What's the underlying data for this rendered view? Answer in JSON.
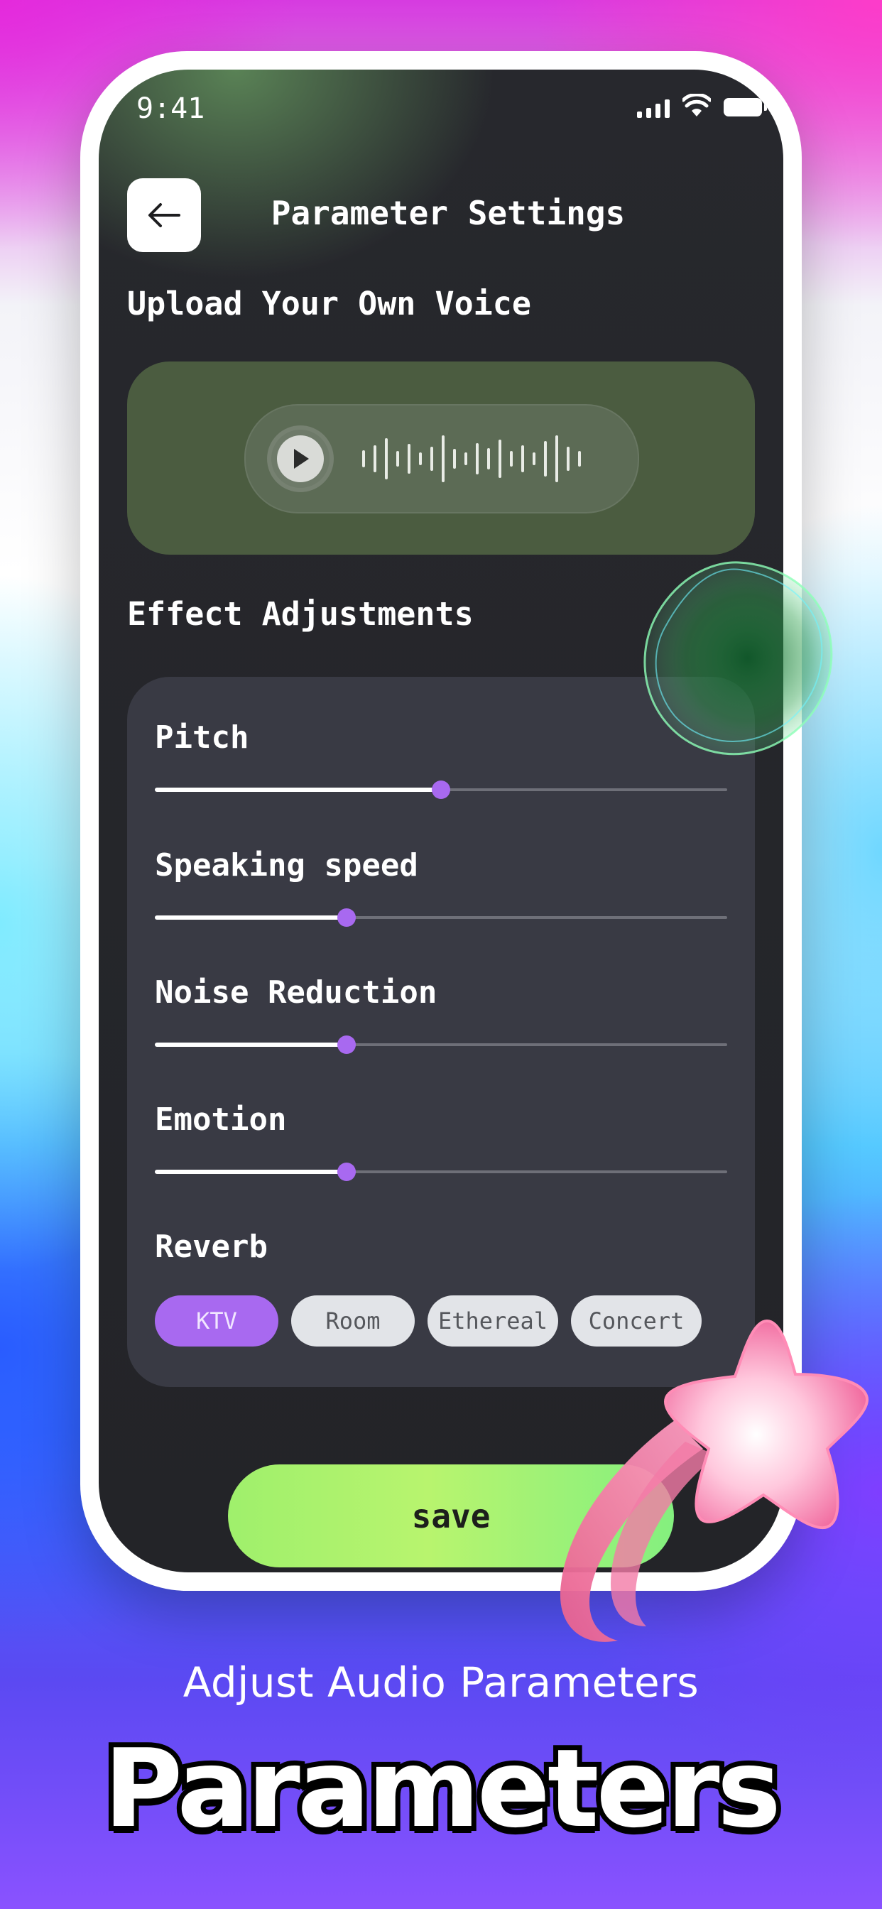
{
  "status_bar": {
    "time": "9:41"
  },
  "header": {
    "title": "Parameter Settings"
  },
  "upload_section": {
    "title": "Upload Your Own Voice"
  },
  "effects_section": {
    "title": "Effect Adjustments",
    "params": [
      {
        "label": "Pitch",
        "value": 0.5
      },
      {
        "label": "Speaking speed",
        "value": 0.335
      },
      {
        "label": "Noise Reduction",
        "value": 0.335
      },
      {
        "label": "Emotion",
        "value": 0.335
      }
    ],
    "reverb": {
      "label": "Reverb",
      "options": [
        "KTV",
        "Room",
        "Ethereal",
        "Concert"
      ],
      "selected": "KTV"
    }
  },
  "save_button": {
    "label": "save"
  },
  "promo": {
    "caption": "Adjust Audio Parameters",
    "headline": "Parameters"
  },
  "colors": {
    "accent": "#a869f0",
    "save_gradient_start": "#9ff06c",
    "save_gradient_end": "#84f07f",
    "voice_card": "#4b5c40",
    "effects_card": "#393a44"
  },
  "icons": {
    "back": "arrow-left-icon",
    "play": "play-icon",
    "waveform": "waveform-icon",
    "signal": "cellular-signal-icon",
    "wifi": "wifi-icon",
    "battery": "battery-icon"
  }
}
